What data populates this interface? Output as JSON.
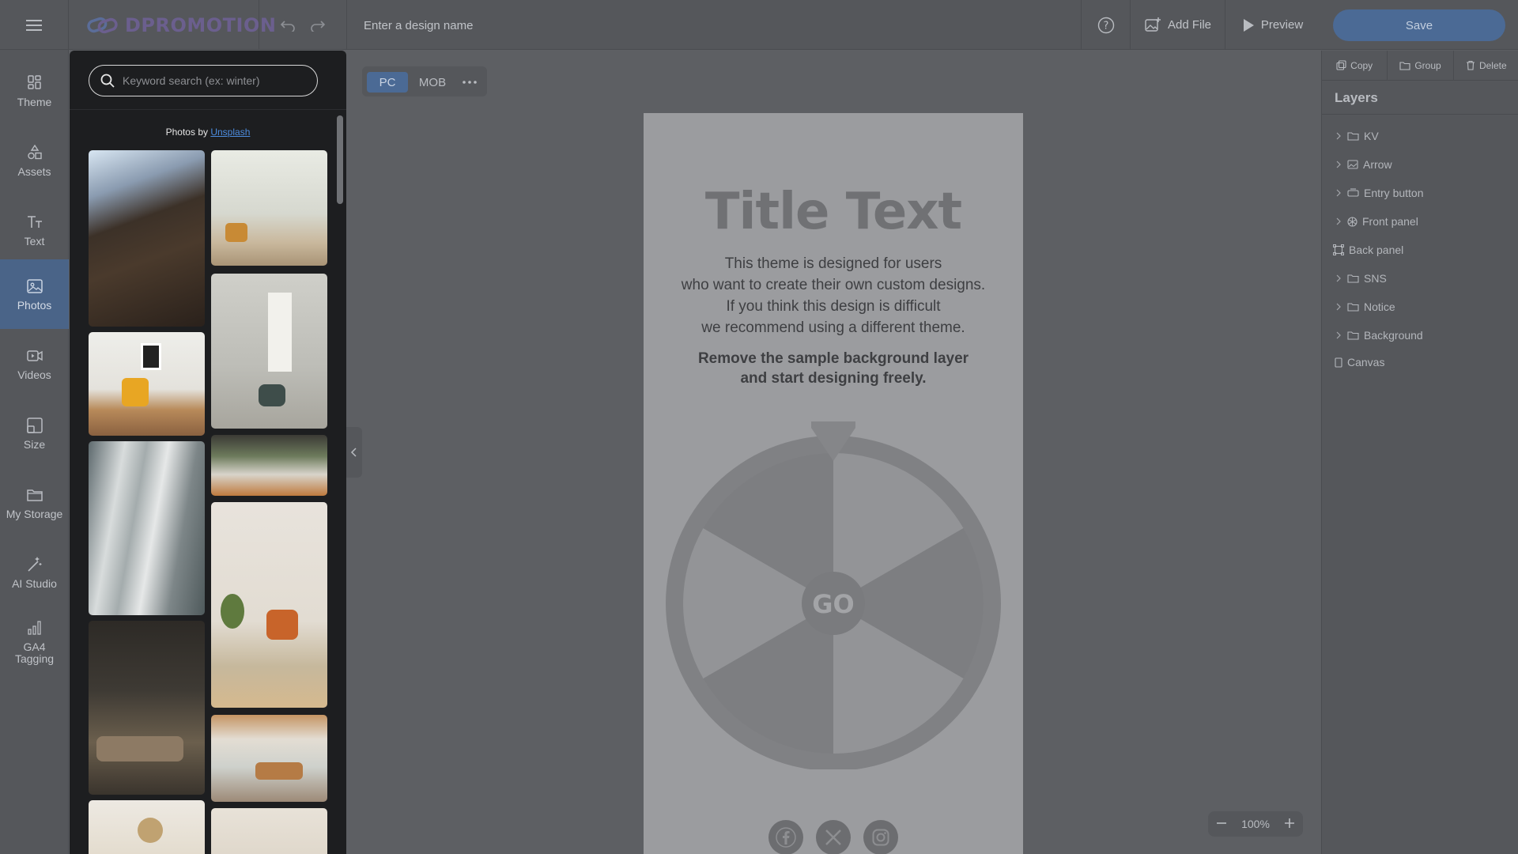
{
  "topbar": {
    "brand": "DPROMOTION",
    "design_name_placeholder": "Enter a design name",
    "add_file_label": "Add File",
    "preview_label": "Preview",
    "save_label": "Save"
  },
  "nav": {
    "items": [
      {
        "label": "Theme",
        "icon": "theme-icon"
      },
      {
        "label": "Assets",
        "icon": "shapes-icon"
      },
      {
        "label": "Text",
        "icon": "text-icon"
      },
      {
        "label": "Photos",
        "icon": "image-icon",
        "active": true
      },
      {
        "label": "Videos",
        "icon": "video-icon"
      },
      {
        "label": "Size",
        "icon": "resize-icon"
      },
      {
        "label": "My Storage",
        "icon": "folder-icon"
      },
      {
        "label": "AI Studio",
        "icon": "magic-wand-icon"
      },
      {
        "label": "GA4 Tagging",
        "icon": "bar-chart-icon"
      }
    ]
  },
  "photos_panel": {
    "search_placeholder": "Keyword search (ex: winter)",
    "credit_prefix": "Photos by",
    "credit_link": "Unsplash"
  },
  "view_toggle": {
    "pc": "PC",
    "mob": "MOB"
  },
  "canvas": {
    "title": "Title Text",
    "desc_lines": [
      "This theme is designed for users",
      "who want to create their own custom designs.",
      "If you think this design is difficult",
      "we recommend using a different theme."
    ],
    "bold_lines": [
      "Remove the sample background layer",
      "and start designing freely."
    ],
    "wheel_center_label": "GO"
  },
  "zoom": {
    "level": "100%"
  },
  "right_panel": {
    "actions": [
      "Copy",
      "Group",
      "Delete"
    ],
    "layers_title": "Layers",
    "layers": [
      {
        "label": "KV",
        "type": "folder",
        "expandable": true
      },
      {
        "label": "Arrow",
        "type": "image",
        "expandable": true
      },
      {
        "label": "Entry button",
        "type": "button",
        "expandable": true
      },
      {
        "label": "Front panel",
        "type": "wheel",
        "expandable": true
      },
      {
        "label": "Back panel",
        "type": "frame",
        "expandable": false
      },
      {
        "label": "SNS",
        "type": "folder",
        "expandable": true
      },
      {
        "label": "Notice",
        "type": "folder",
        "expandable": true
      },
      {
        "label": "Background",
        "type": "folder",
        "expandable": true
      },
      {
        "label": "Canvas",
        "type": "page",
        "expandable": false
      }
    ]
  },
  "colors": {
    "accent": "#4b6a95",
    "brand": "#6b5f8e",
    "canvas_bg": "#9b9c9f"
  }
}
